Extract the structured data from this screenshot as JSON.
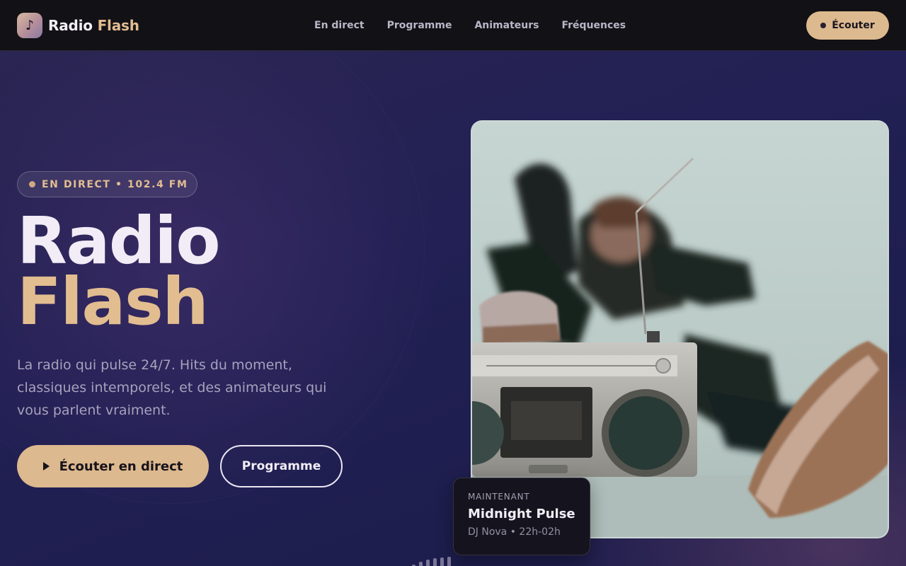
{
  "nav": {
    "brand": {
      "icon": "music-note-icon",
      "name": "Radio",
      "accent": "Flash"
    },
    "links": [
      "En direct",
      "Programme",
      "Animateurs",
      "Fréquences"
    ],
    "cta_label": "Écouter"
  },
  "hero": {
    "badge": "EN DIRECT • 102.4 FM",
    "title_line1": "Radio",
    "title_line2": "Flash",
    "description": "La radio qui pulse 24/7. Hits du moment, classiques intemporels, et des animateurs qui vous parlent vraiment.",
    "primary_button": "Écouter en direct",
    "secondary_button": "Programme",
    "image_icon": "boombox-photo"
  },
  "now_playing": {
    "label": "MAINTENANT",
    "show": "Midnight Pulse",
    "meta": "DJ Nova • 22h-02h"
  },
  "colors": {
    "accent": "#dcb98e",
    "nav_bg": "#121116",
    "hero_bg": "#1c1d45"
  }
}
